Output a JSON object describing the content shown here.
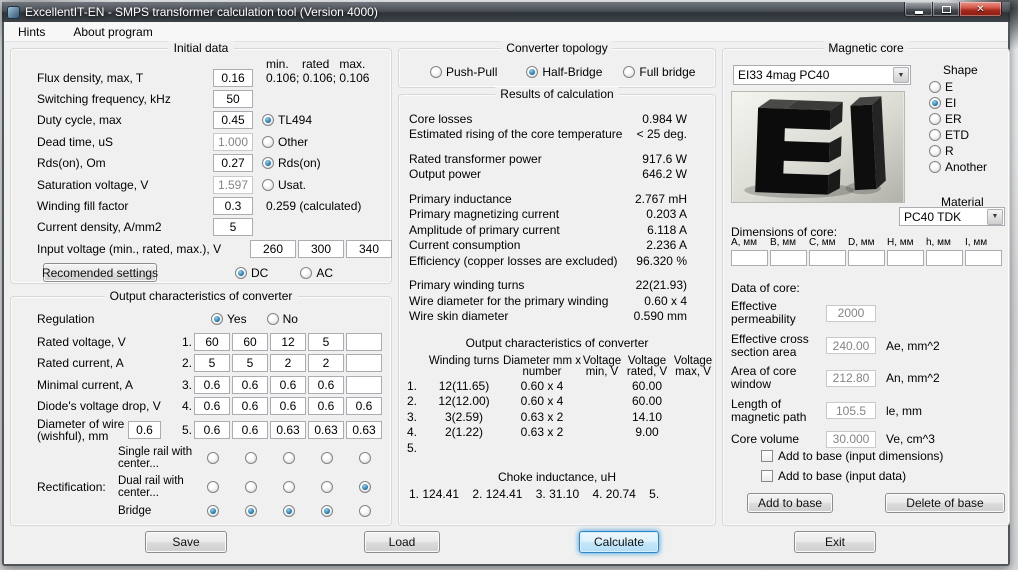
{
  "window": {
    "title": "ExcellentIT-EN - SMPS transformer calculation tool (Version 4000)"
  },
  "menu": {
    "hints": "Hints",
    "about": "About program"
  },
  "initial": {
    "title": "Initial data",
    "cols_header": "min.    rated   max.",
    "rows": {
      "flux": {
        "label": "Flux density, max, T",
        "value": "0.16",
        "note": "0.106; 0.106; 0.106"
      },
      "freq": {
        "label": "Switching frequency, kHz",
        "value": "50"
      },
      "duty": {
        "label": "Duty cycle, max",
        "value": "0.45",
        "radio": "TL494"
      },
      "dead": {
        "label": "Dead time, uS",
        "value": "1.000",
        "radio": "Other"
      },
      "rds": {
        "label": "Rds(on), Om",
        "value": "0.27",
        "radio": "Rds(on)"
      },
      "sat": {
        "label": "Saturation voltage, V",
        "value": "1.597",
        "radio": "Usat."
      },
      "fill": {
        "label": "Winding fill factor",
        "value": "0.3",
        "note": "0.259 (calculated)"
      },
      "dens": {
        "label": "Current density, A/mm2",
        "value": "5"
      },
      "vin": {
        "label": "Input voltage (min., rated, max.), V",
        "min": "260",
        "rated": "300",
        "max": "340"
      }
    },
    "recommended_btn": "Recomended settings",
    "dc": "DC",
    "ac": "AC"
  },
  "outchar": {
    "title": "Output characteristics of converter",
    "regulation": {
      "label": "Regulation",
      "yes": "Yes",
      "no": "No"
    },
    "grid": [
      {
        "num": "1.",
        "label": "Rated voltage, V",
        "values": [
          "60",
          "60",
          "12",
          "5",
          ""
        ]
      },
      {
        "num": "2.",
        "label": "Rated current, A",
        "values": [
          "5",
          "5",
          "2",
          "2",
          ""
        ]
      },
      {
        "num": "3.",
        "label": "Minimal current, A",
        "values": [
          "0.6",
          "0.6",
          "0.6",
          "0.6",
          ""
        ]
      },
      {
        "num": "4.",
        "label": "Diode's voltage drop, V",
        "values": [
          "0.6",
          "0.6",
          "0.6",
          "0.6",
          "0.6"
        ]
      },
      {
        "num": "5.",
        "label": "Diameter of wire (wishful), mm",
        "wishful": "0.6",
        "values": [
          "0.6",
          "0.6",
          "0.63",
          "0.63",
          "0.63"
        ]
      }
    ],
    "rectification": {
      "label": "Rectification:",
      "single": "Single rail with center...",
      "dual": "Dual rail with center...",
      "bridge": "Bridge"
    }
  },
  "topology": {
    "title": "Converter topology",
    "push_pull": "Push-Pull",
    "half_bridge": "Half-Bridge",
    "full_bridge": "Full bridge",
    "selected": "Half-Bridge"
  },
  "results": {
    "title": "Results of calculation",
    "items": [
      {
        "label": "Core losses",
        "value": "0.984 W"
      },
      {
        "label": "Estimated rising of the core temperature",
        "value": "< 25 deg."
      },
      {
        "label": "Rated transformer power",
        "value": "917.6 W"
      },
      {
        "label": "Output power",
        "value": "646.2 W"
      },
      {
        "label": "Primary inductance",
        "value": "2.767 mH"
      },
      {
        "label": "Primary magnetizing current",
        "value": "0.203 A"
      },
      {
        "label": "Amplitude of primary current",
        "value": "6.118 A"
      },
      {
        "label": "Current consumption",
        "value": "2.236 A"
      },
      {
        "label": "Efficiency (copper losses are excluded)",
        "value": "96.320 %"
      },
      {
        "label": "Primary winding turns",
        "value": "22(21.93)"
      },
      {
        "label": "Wire diameter for the primary winding",
        "value": "0.60 x 4"
      },
      {
        "label": "Wire skin diameter",
        "value": "0.590 mm"
      }
    ],
    "table": {
      "title": "Output characteristics of converter",
      "headers": [
        "Winding turns",
        "Diameter mm x number",
        "Voltage min, V",
        "Voltage rated, V",
        "Voltage max, V"
      ],
      "rows": [
        {
          "num": "1.",
          "turns": "12(11.65)",
          "wire": "0.60 x 4",
          "vmin": "",
          "vrated": "60.00",
          "vmax": ""
        },
        {
          "num": "2.",
          "turns": "12(12.00)",
          "wire": "0.60 x 4",
          "vmin": "",
          "vrated": "60.00",
          "vmax": ""
        },
        {
          "num": "3.",
          "turns": "3(2.59)",
          "wire": "0.63 x 2",
          "vmin": "",
          "vrated": "14.10",
          "vmax": ""
        },
        {
          "num": "4.",
          "turns": "2(1.22)",
          "wire": "0.63 x 2",
          "vmin": "",
          "vrated": "9.00",
          "vmax": ""
        },
        {
          "num": "5.",
          "turns": "",
          "wire": "",
          "vmin": "",
          "vrated": "",
          "vmax": ""
        }
      ]
    },
    "choke": {
      "title": "Choke inductance, uH",
      "line": "1. 124.41    2. 124.41    3. 31.10    4. 20.74    5."
    }
  },
  "core": {
    "title": "Magnetic core",
    "selected": "EI33 4mag PC40",
    "shape": {
      "label": "Shape",
      "options": [
        "E",
        "EI",
        "ER",
        "ETD",
        "R",
        "Another"
      ],
      "selected": "EI"
    },
    "material": {
      "label": "Material",
      "value": "PC40 TDK"
    },
    "dimensions": {
      "label": "Dimensions of core:",
      "fields": [
        "A, мм",
        "B, мм",
        "C, мм",
        "D, мм",
        "H, мм",
        "h, мм",
        "I, мм"
      ]
    },
    "data": {
      "label": "Data of core:",
      "items": [
        {
          "label": "Effective permeability",
          "value": "2000",
          "unit": ""
        },
        {
          "label": "Effective cross section area",
          "value": "240.00",
          "unit": "Ae, mm^2"
        },
        {
          "label": "Area of core window",
          "value": "212.80",
          "unit": "An, mm^2"
        },
        {
          "label": "Length of magnetic path",
          "value": "105.5",
          "unit": "le, mm"
        },
        {
          "label": "Core volume",
          "value": "30.000",
          "unit": "Ve, cm^3"
        }
      ]
    },
    "add_dim_checkbox": "Add to base (input dimensions)",
    "add_data_checkbox": "Add to base (input data)",
    "add_btn": "Add to base",
    "delete_btn": "Delete of base"
  },
  "footer": {
    "save": "Save",
    "load": "Load",
    "calculate": "Calculate",
    "exit": "Exit"
  }
}
